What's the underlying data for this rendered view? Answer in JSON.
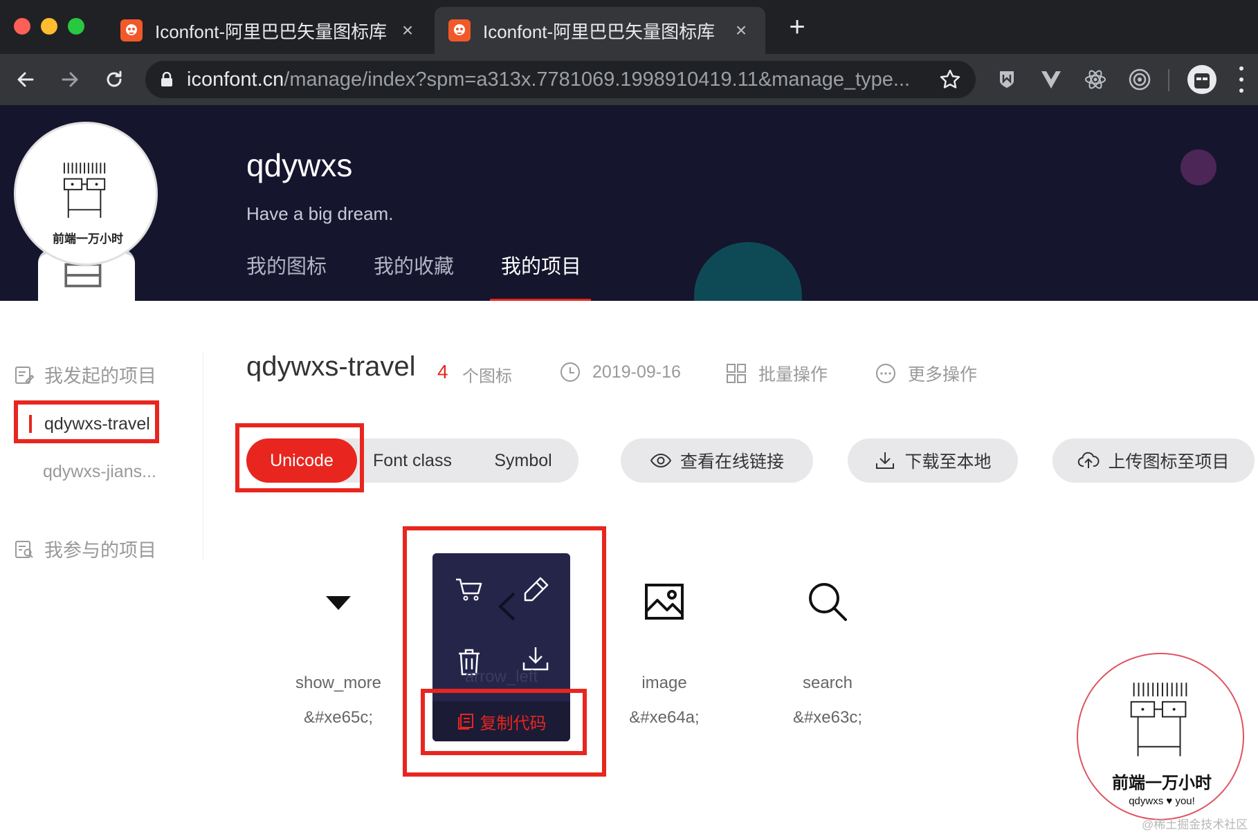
{
  "browser": {
    "tabs": [
      {
        "title": "Iconfont-阿里巴巴矢量图标库",
        "active": false
      },
      {
        "title": "Iconfont-阿里巴巴矢量图标库",
        "active": true
      }
    ],
    "new_tab_glyph": "+",
    "close_glyph": "×",
    "url_host": "iconfont.cn",
    "url_path": "/manage/index?spm=a313x.7781069.1998910419.11&manage_type...",
    "icons": [
      "back-icon",
      "forward-icon",
      "reload-icon",
      "lock-icon",
      "star-icon",
      "shield-extension-icon",
      "vue-extension-icon",
      "react-extension-icon",
      "target-extension-icon",
      "profile-avatar",
      "menu-icon"
    ]
  },
  "header": {
    "username": "qdywxs",
    "motto": "Have a big dream.",
    "avatar_caption": "前端一万小时",
    "tabs": [
      {
        "label": "我的图标",
        "active": false
      },
      {
        "label": "我的收藏",
        "active": false
      },
      {
        "label": "我的项目",
        "active": true
      }
    ],
    "accent_color": "#e8261f",
    "background_color": "#15152e"
  },
  "sidebar": {
    "my_projects_title": "我发起的项目",
    "projects": [
      {
        "label": "qdywxs-travel",
        "active": true
      },
      {
        "label": "qdywxs-jians...",
        "active": false
      }
    ],
    "joined_projects_title": "我参与的项目"
  },
  "project": {
    "name": "qdywxs-travel",
    "icon_count": "4",
    "icon_count_unit": "个图标",
    "date": "2019-09-16",
    "batch_label": "批量操作",
    "more_label": "更多操作",
    "modes": [
      {
        "label": "Unicode",
        "active": true
      },
      {
        "label": "Font class",
        "active": false
      },
      {
        "label": "Symbol",
        "active": false
      }
    ],
    "actions": {
      "view_link": "查看在线链接",
      "download": "下载至本地",
      "upload": "上传图标至项目"
    }
  },
  "icons": [
    {
      "name": "show_more",
      "code": "&#xe65c;",
      "glyph": "caret-down-icon"
    },
    {
      "name": "arrow_left",
      "code": "",
      "glyph": "arrow-left-icon"
    },
    {
      "name": "image",
      "code": "&#xe64a;",
      "glyph": "image-icon"
    },
    {
      "name": "search",
      "code": "&#xe63c;",
      "glyph": "search-icon"
    }
  ],
  "hover_card": {
    "copy_label": "复制代码",
    "actions": [
      "cart-icon",
      "edit-icon",
      "delete-icon",
      "download-icon"
    ]
  },
  "sticker": {
    "title": "前端一万小时",
    "subtitle": "qdywxs ♥ you!"
  },
  "watermark": "@稀土掘金技术社区"
}
